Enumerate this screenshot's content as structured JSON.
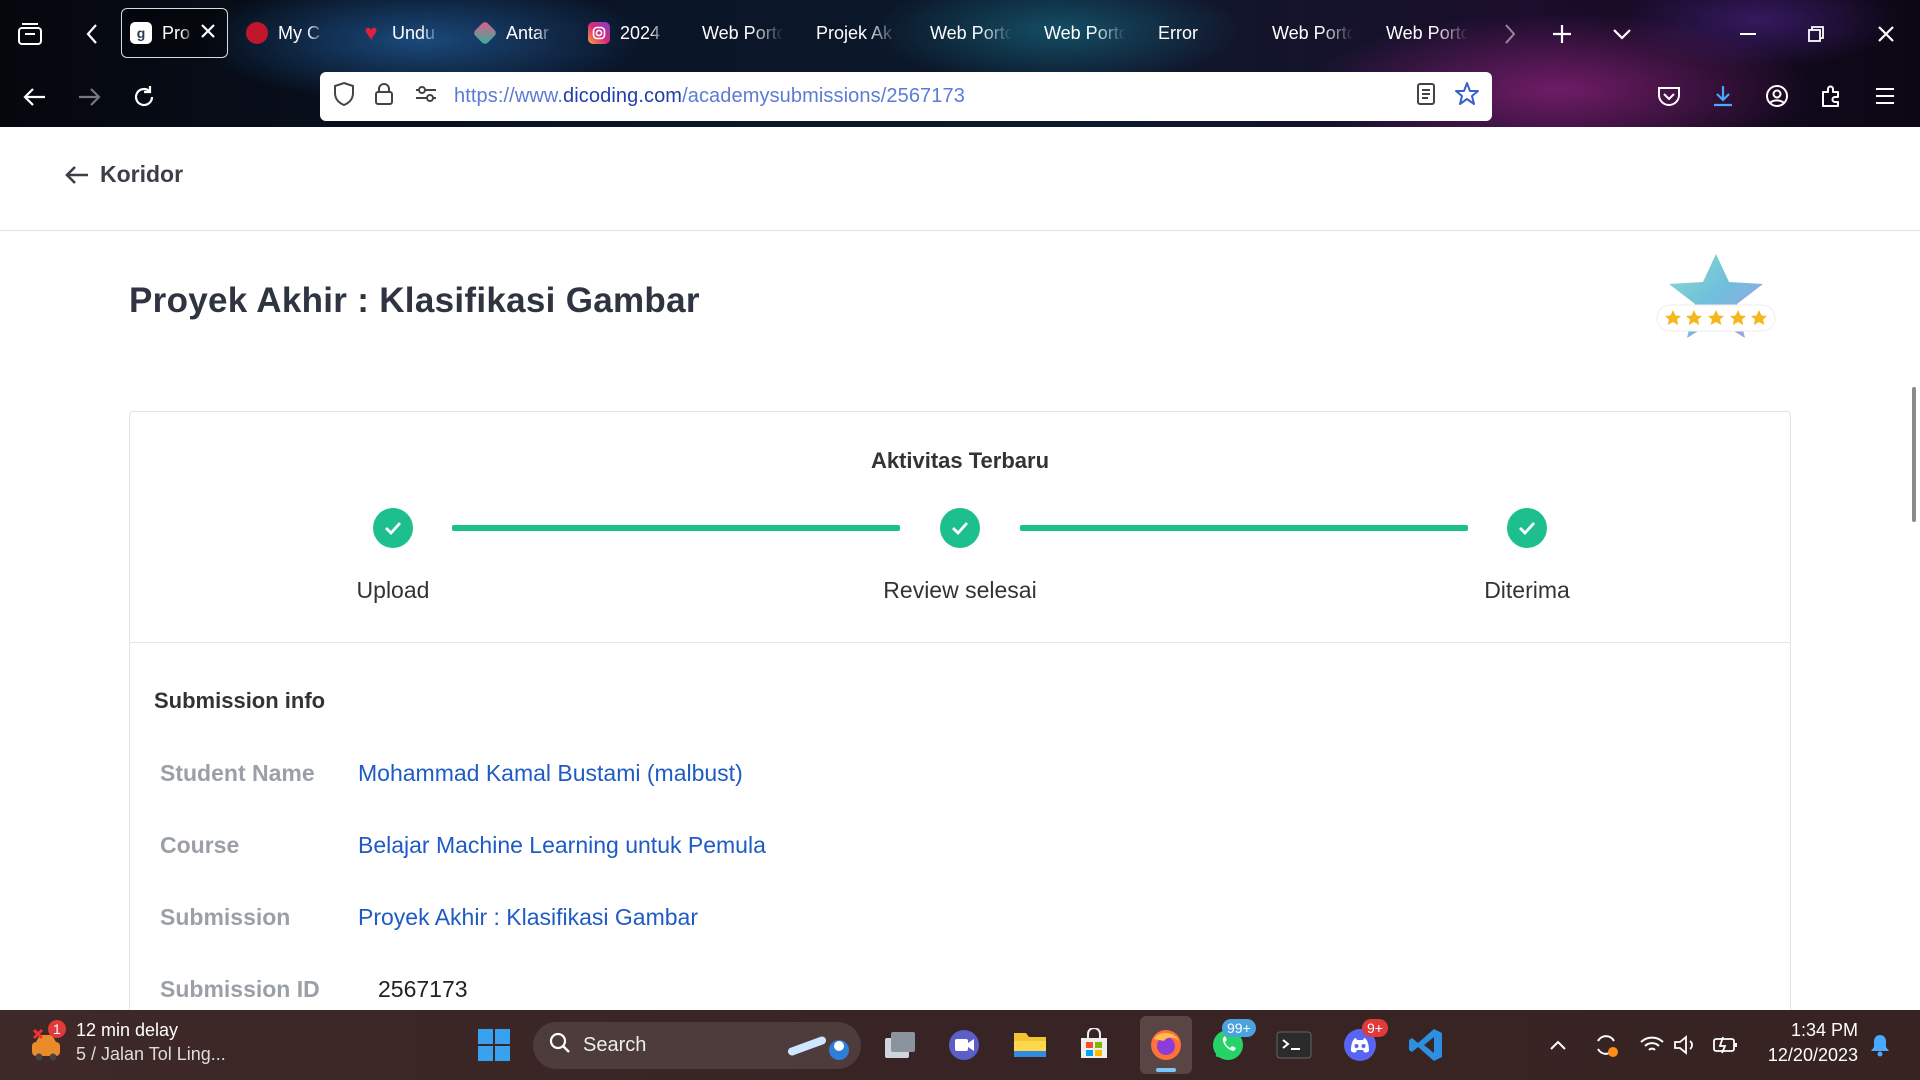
{
  "browser": {
    "tabs": [
      {
        "label": "Pro",
        "active": true
      },
      {
        "label": "My C"
      },
      {
        "label": "Undu"
      },
      {
        "label": "Antar"
      },
      {
        "label": "2024"
      },
      {
        "label": "Web Porto"
      },
      {
        "label": "Projek Ak"
      },
      {
        "label": "Web Porto"
      },
      {
        "label": "Web Porto"
      },
      {
        "label": "Error"
      },
      {
        "label": "Web Porto"
      },
      {
        "label": "Web Porto"
      }
    ],
    "url_prefix": "https://www.",
    "url_domain": "dicoding.com",
    "url_path": "/academysubmissions/2567173"
  },
  "page": {
    "back_label": "Koridor",
    "title": "Proyek Akhir : Klasifikasi Gambar",
    "activity": {
      "title": "Aktivitas Terbaru",
      "steps": [
        {
          "label": "Upload"
        },
        {
          "label": "Review selesai"
        },
        {
          "label": "Diterima"
        }
      ]
    },
    "submission_info": {
      "heading": "Submission info",
      "student_name_label": "Student Name",
      "student_name": "Mohammad Kamal Bustami (malbust)",
      "course_label": "Course",
      "course": "Belajar Machine Learning untuk Pemula",
      "submission_label": "Submission",
      "submission": "Proyek Akhir : Klasifikasi Gambar",
      "submission_id_label": "Submission ID",
      "submission_id": "2567173"
    },
    "accent_color": "#1ebf8e",
    "link_color": "#1f5bc4"
  },
  "taskbar": {
    "traffic_title": "12 min delay",
    "traffic_detail": "5 / Jalan Tol Ling...",
    "traffic_badge": "1",
    "search_label": "Search",
    "whatsapp_badge": "99+",
    "discord_badge": "9+",
    "time": "1:34 PM",
    "date": "12/20/2023"
  }
}
